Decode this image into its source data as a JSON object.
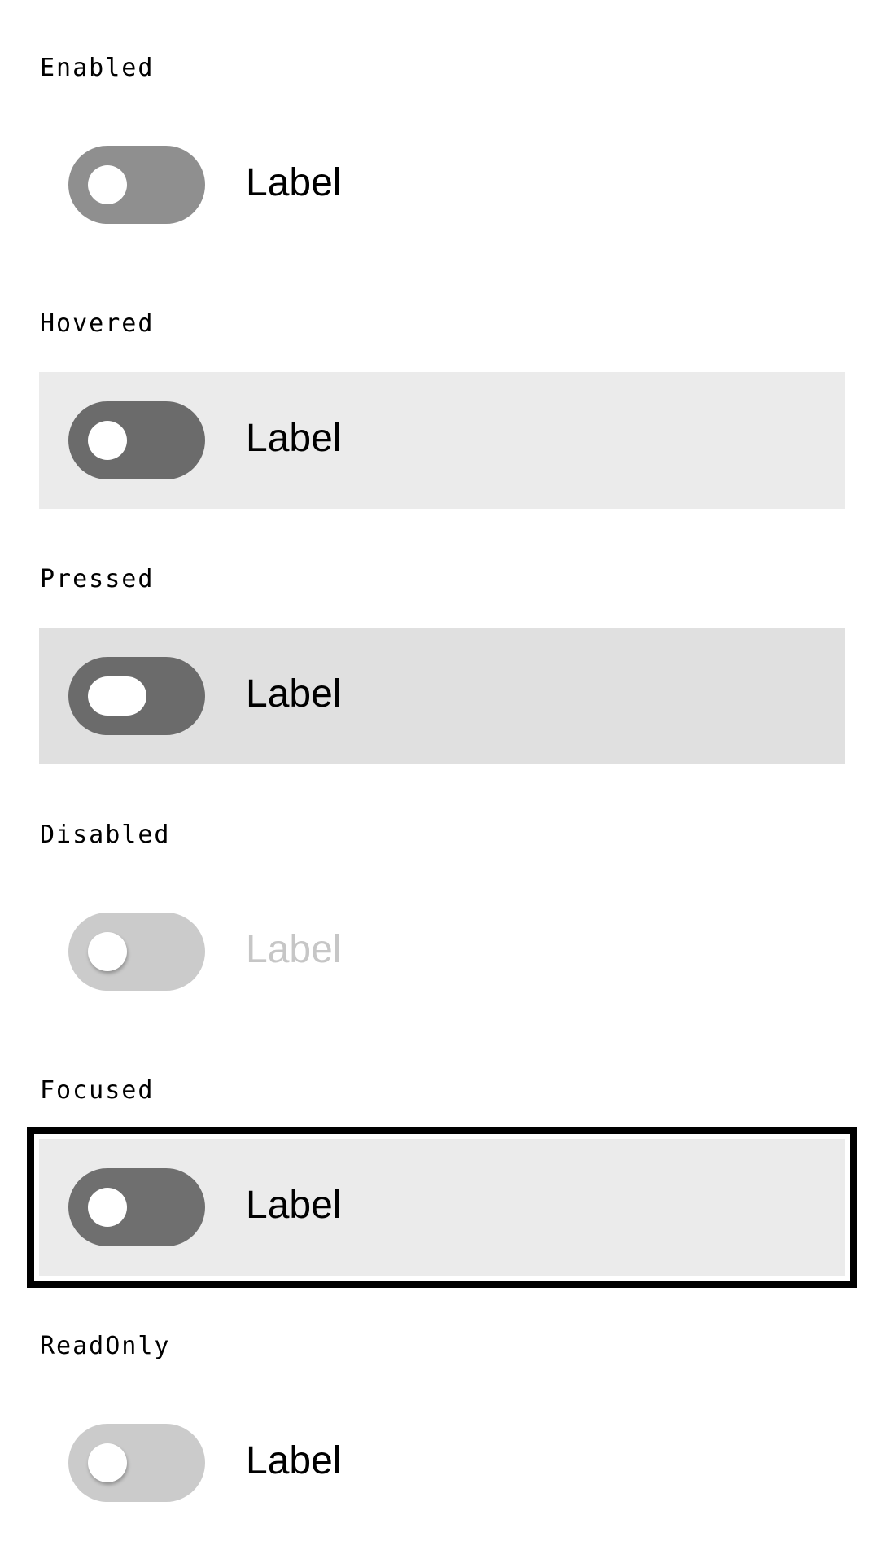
{
  "states": [
    {
      "caption": "Enabled",
      "label": "Label",
      "track_color": "#8f8f8f",
      "label_color": "#000000"
    },
    {
      "caption": "Hovered",
      "label": "Label",
      "track_color": "#6b6b6b",
      "label_color": "#000000",
      "row_color": "#ebebeb"
    },
    {
      "caption": "Pressed",
      "label": "Label",
      "track_color": "#6b6b6b",
      "label_color": "#000000",
      "row_color": "#e0e0e0"
    },
    {
      "caption": "Disabled",
      "label": "Label",
      "track_color": "#cbcbcb",
      "label_color": "#c6c6c6"
    },
    {
      "caption": "Focused",
      "label": "Label",
      "track_color": "#6f6f6f",
      "label_color": "#000000",
      "row_color": "#ebebeb",
      "focus_ring_color": "#000000"
    },
    {
      "caption": "ReadOnly",
      "label": "Label",
      "track_color": "#cbcbcb",
      "label_color": "#000000"
    }
  ],
  "switches_on": false,
  "thumb_color": "#ffffff"
}
